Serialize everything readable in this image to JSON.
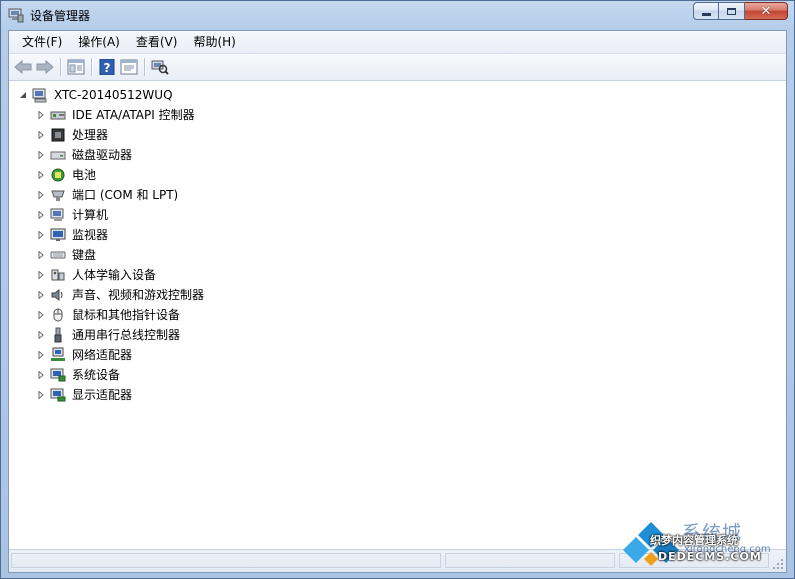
{
  "window": {
    "title": "设备管理器",
    "caption_buttons": [
      "minimize-icon",
      "maximize-icon",
      "close-icon"
    ]
  },
  "menubar": {
    "items": [
      "文件(F)",
      "操作(A)",
      "查看(V)",
      "帮助(H)"
    ]
  },
  "toolbar": {
    "buttons": [
      "back-arrow-icon",
      "forward-arrow-icon",
      "show-hide-console-tree-icon",
      "help-icon",
      "properties-icon",
      "scan-hardware-icon"
    ]
  },
  "tree": {
    "root": {
      "label": "XTC-20140512WUQ",
      "icon": "computer-icon",
      "expanded": true
    },
    "categories": [
      {
        "label": "IDE ATA/ATAPI 控制器",
        "icon": "ide-controller-icon"
      },
      {
        "label": "处理器",
        "icon": "processor-icon"
      },
      {
        "label": "磁盘驱动器",
        "icon": "disk-drive-icon"
      },
      {
        "label": "电池",
        "icon": "battery-icon"
      },
      {
        "label": "端口 (COM 和 LPT)",
        "icon": "port-icon"
      },
      {
        "label": "计算机",
        "icon": "computer-icon"
      },
      {
        "label": "监视器",
        "icon": "monitor-icon"
      },
      {
        "label": "键盘",
        "icon": "keyboard-icon"
      },
      {
        "label": "人体学输入设备",
        "icon": "hid-icon"
      },
      {
        "label": "声音、视频和游戏控制器",
        "icon": "sound-icon"
      },
      {
        "label": "鼠标和其他指针设备",
        "icon": "mouse-icon"
      },
      {
        "label": "通用串行总线控制器",
        "icon": "usb-icon"
      },
      {
        "label": "网络适配器",
        "icon": "network-adapter-icon"
      },
      {
        "label": "系统设备",
        "icon": "system-device-icon"
      },
      {
        "label": "显示适配器",
        "icon": "display-adapter-icon"
      }
    ]
  },
  "watermark": {
    "brand_cn": "系统城",
    "url": "xitongcheng.com",
    "cms_cn": "织梦内容管理系统",
    "cms_domain": "DEDECMS.COM"
  },
  "colors": {
    "title_gradient_top": "#c5d9f1",
    "close_button": "#c0452f",
    "watermark_blue": "#1e8fd6"
  }
}
